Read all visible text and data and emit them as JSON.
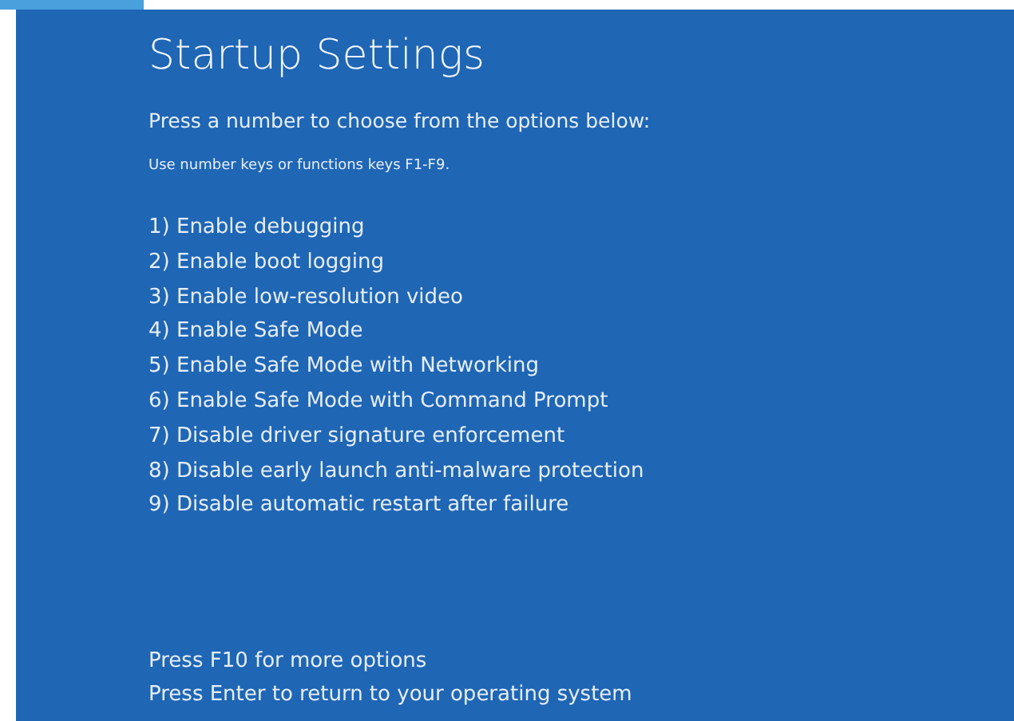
{
  "title": "Startup Settings",
  "instruction": "Press a number to choose from the options below:",
  "hint": "Use number keys or functions keys F1-F9.",
  "options": [
    {
      "label": "1) Enable debugging"
    },
    {
      "label": "2) Enable boot logging"
    },
    {
      "label": "3) Enable low-resolution video"
    },
    {
      "label": "4) Enable Safe Mode"
    },
    {
      "label": "5) Enable Safe Mode with Networking"
    },
    {
      "label": "6) Enable Safe Mode with Command Prompt"
    },
    {
      "label": "7) Disable driver signature enforcement"
    },
    {
      "label": "8) Disable early launch anti-malware protection"
    },
    {
      "label": "9) Disable automatic restart after failure"
    }
  ],
  "footer": [
    "Press F10 for more options",
    "Press Enter to return to your operating system"
  ]
}
